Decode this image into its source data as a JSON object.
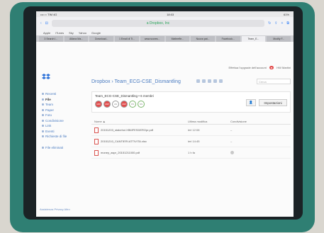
{
  "status": {
    "left": "•••○○ TIM 4G",
    "time": "18:03",
    "right": "61%"
  },
  "safari": {
    "url": "a Dropbox, Inc"
  },
  "bookmarks": [
    "Apple",
    "iTunes",
    "Sky",
    "Yahoo",
    "Google"
  ],
  "tabs": [
    "3 Search I...",
    "Allianz Ma...",
    "Download...",
    "1 Email di Ti...",
    "www.scores...",
    "Mathrefle...",
    "Nuova pat...",
    "Facebook...",
    "Team_E...",
    "Modify F..."
  ],
  "sidebar": {
    "items": [
      "Recenti",
      "File",
      "Team",
      "Paper",
      "Foto",
      "Condivisione",
      "Link",
      "Eventi",
      "Richieste di file",
      "File eliminati"
    ],
    "bottom_links": "Assistenza  Privacy  Altro"
  },
  "header": {
    "notice": "Effettua l'upgrade dell'account",
    "user": "HW Martini"
  },
  "breadcrumb": "Dropbox › Team_ECG-CSE_Dismantling",
  "search_placeholder": "Cerca",
  "folder": {
    "title": "Team_ECG-CSE_Dismantling • 6 membri",
    "avatars": [
      "MW",
      "MW",
      "AS",
      "MW",
      "FS",
      "SS"
    ],
    "button": "Impostazioni"
  },
  "table": {
    "headers": [
      "Nome ▲",
      "Ultima modifica",
      "Condivisione"
    ],
    "rows": [
      {
        "name": "20151203_stakehol.XBMFESDEROpr.pdf",
        "modified": "ieri 12:08",
        "shared": "–"
      },
      {
        "name": "20151210_CANTIERI.ATTIVITA.xlsx",
        "modified": "ieri 14:45",
        "shared": "–"
      },
      {
        "name": "money_aspr_20151211000.pdf",
        "modified": "1 h fa",
        "shared": ""
      }
    ]
  },
  "colors": {
    "case": "#2f7f73",
    "accent": "#4a7bc0",
    "avatar": "#e24d4d"
  }
}
